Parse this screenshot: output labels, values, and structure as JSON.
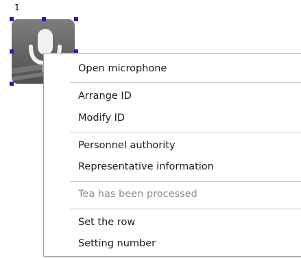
{
  "device": {
    "id_label": "1",
    "icon": "microphone-icon"
  },
  "context_menu": {
    "items": [
      {
        "label": "Open microphone",
        "enabled": true
      },
      {
        "label": "Arrange ID",
        "enabled": true
      },
      {
        "label": "Modify ID",
        "enabled": true
      },
      {
        "label": "Personnel authority",
        "enabled": true
      },
      {
        "label": "Representative information",
        "enabled": true
      },
      {
        "label": "Tea has been processed",
        "enabled": false
      },
      {
        "label": "Set the row",
        "enabled": true
      },
      {
        "label": "Setting number",
        "enabled": true
      }
    ]
  },
  "colors": {
    "selection_handle": "#1c1cc8",
    "disabled_text": "#8c8c8c",
    "separator": "#c8c8c8"
  }
}
